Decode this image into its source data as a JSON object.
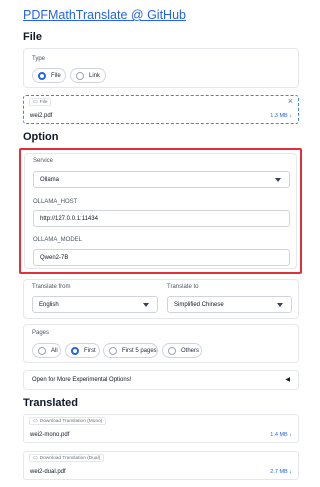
{
  "header": {
    "title_link": "PDFMathTranslate @ GitHub"
  },
  "file_section": {
    "heading": "File",
    "type_label": "Type",
    "type_options": [
      {
        "label": "File",
        "selected": true
      },
      {
        "label": "Link",
        "selected": false
      }
    ],
    "upload": {
      "tag": "File",
      "filename": "wei2.pdf",
      "size": "1.3 MB",
      "download_glyph": "↓",
      "close_glyph": "×"
    }
  },
  "option_section": {
    "heading": "Option",
    "service_label": "Service",
    "service_value": "Ollama",
    "ollama_host_label": "OLLAMA_HOST",
    "ollama_host_value": "http://127.0.0.1:11434",
    "ollama_model_label": "OLLAMA_MODEL",
    "ollama_model_value": "Qwen2-7B",
    "highlight_color": "#e0303a",
    "translate_from_label": "Translate from",
    "translate_from_value": "English",
    "translate_to_label": "Translate to",
    "translate_to_value": "Simplified Chinese",
    "pages_label": "Pages",
    "pages_options": [
      {
        "label": "All",
        "selected": false
      },
      {
        "label": "First",
        "selected": true
      },
      {
        "label": "First 5 pages",
        "selected": false
      },
      {
        "label": "Others",
        "selected": false
      }
    ],
    "experimental_label": "Open for More Experimental Options!",
    "experimental_glyph": "◀"
  },
  "translated_section": {
    "heading": "Translated",
    "mono": {
      "tag": "Download Translation (Mono)",
      "filename": "wei2-mono.pdf",
      "size": "1.4 MB",
      "download_glyph": "↓"
    },
    "dual": {
      "tag": "Download Translation (Dual)",
      "filename": "wei2-dual.pdf",
      "size": "2.7 MB",
      "download_glyph": "↓"
    }
  },
  "colors": {
    "accent": "#2563eb",
    "highlight": "#e0303a"
  }
}
